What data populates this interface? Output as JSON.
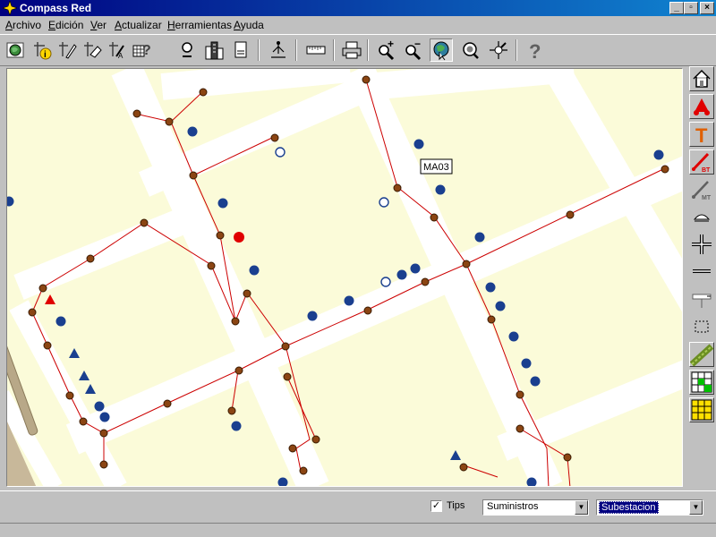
{
  "window": {
    "title": "Compass Red",
    "minimize": "_",
    "restore": "▫",
    "close": "×"
  },
  "menu": [
    {
      "label": "Archivo",
      "underline": "A",
      "rest": "rchivo"
    },
    {
      "label": "Edición",
      "underline": "E",
      "rest": "dición"
    },
    {
      "label": "Ver",
      "underline": "V",
      "rest": "er"
    },
    {
      "label": "Actualizar",
      "underline": "A",
      "rest": "ctualizar"
    },
    {
      "label": "Herramientas",
      "underline": "H",
      "rest": "erramientas"
    },
    {
      "label": "Ayuda",
      "underline": "A",
      "rest": "yuda"
    }
  ],
  "toolbar": {
    "tools": [
      "globe-icon",
      "info-node-icon",
      "edit-line-icon",
      "erase-line-icon",
      "edit-text-icon",
      "query-table-icon",
      "search-person-icon",
      "buildings-icon",
      "report-icon",
      "survey-icon",
      "ruler-icon",
      "print-icon",
      "zoom-in-icon",
      "zoom-out-icon",
      "pan-globe-icon",
      "zoom-window-icon",
      "compass-icon",
      "help-icon"
    ],
    "zoom_in_label": "+",
    "zoom_out_label": "−",
    "help_label": "?"
  },
  "map": {
    "label_ma03": "MA03",
    "colors": {
      "block": "#fbfbd9",
      "street": "#ffffff",
      "line": "#d00000",
      "node": "#8b4513",
      "customer": "#1a3f8f",
      "alert": "#e00000"
    }
  },
  "sidebar": {
    "tools": [
      "home-icon",
      "transformer-icon",
      "t-pole-icon",
      "bt-line-icon",
      "mt-line-icon",
      "lamp-icon",
      "cross-junction-icon",
      "line-segment-icon",
      "dimension-icon",
      "select-rect-icon",
      "pipe-icon",
      "grid-green-icon",
      "grid-yellow-icon"
    ],
    "bt_label": "BT",
    "mt_label": "MT",
    "t_label": "T"
  },
  "status": {
    "tips_checked": "✓",
    "tips_label": "Tips",
    "combo1_value": "Suministros",
    "combo2_value": "Subestacion",
    "arrow": "▼"
  }
}
